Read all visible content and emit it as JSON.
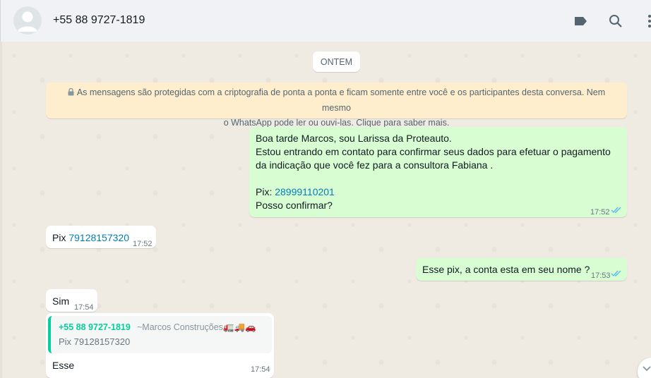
{
  "header": {
    "contact_name": "+55 88 9727-1819",
    "icons": [
      "avatar-icon",
      "label-icon",
      "search-icon",
      "menu-icon"
    ]
  },
  "chat": {
    "date_label": "ONTEM",
    "encryption_notice": {
      "line1": "As mensagens são protegidas com a criptografia de ponta a ponta e ficam somente entre você e os participantes desta conversa. Nem mesmo",
      "line2": "o WhatsApp pode ler ou ouvi-las. Clique para saber mais."
    },
    "messages": [
      {
        "direction": "out",
        "lines": [
          "Boa tarde  Marcos, sou Larissa da Proteauto.",
          "Estou entrando em contato para confirmar seus dados para efetuar o pagamento",
          "da indicação que você fez para a consultora Fabiana ."
        ],
        "pix_label": "Pix: ",
        "pix_number": "28999110201",
        "last_line": "Posso confirmar?",
        "time": "17:52"
      },
      {
        "direction": "in",
        "prefix": "Pix ",
        "number": "79128157320",
        "time": "17:52"
      },
      {
        "direction": "out",
        "text": "Esse pix, a conta esta em seu nome ?",
        "time": "17:53"
      },
      {
        "direction": "in",
        "text": "Sim",
        "time": "17:54"
      },
      {
        "direction": "in",
        "quote": {
          "sender": "+55 88 9727-1819",
          "author": "~Marcos Construções",
          "author_emoji": "🚛🚚🚗",
          "text": "Pix 79128157320"
        },
        "text": "Esse",
        "time": "17:54"
      }
    ]
  },
  "colors": {
    "outgoing_bubble": "#d9fdd3",
    "incoming_bubble": "#ffffff",
    "encryption_bg": "#ffeecd",
    "quote_accent": "#06cf9c",
    "link": "#027eb5",
    "read_ticks": "#53bdeb"
  }
}
